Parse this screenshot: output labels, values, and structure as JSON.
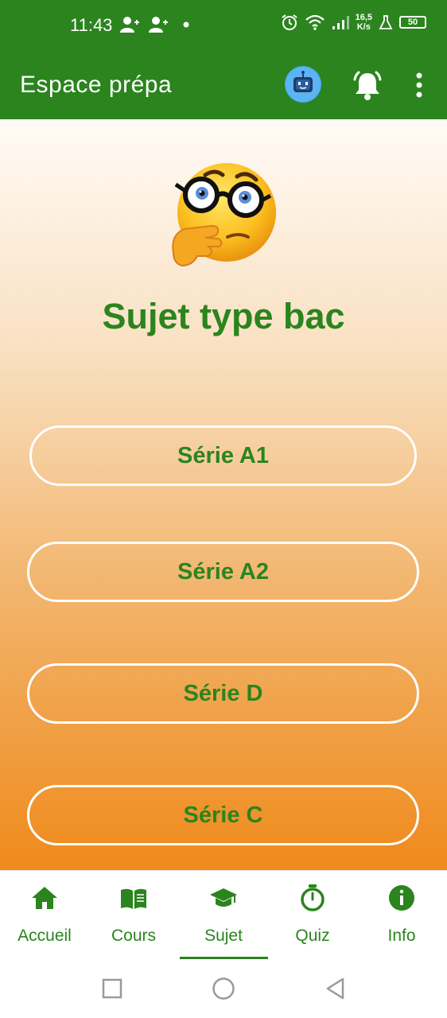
{
  "status_bar": {
    "time": "11:43",
    "speed_value": "16,5",
    "speed_unit": "K/s",
    "battery": "50",
    "icons": [
      "person-add-icon",
      "person-add-icon",
      "dot-icon",
      "alarm-icon",
      "wifi-icon",
      "signal-icon",
      "flask-icon",
      "battery-icon"
    ]
  },
  "app_bar": {
    "title": "Espace prépa",
    "icons": [
      "bot-icon",
      "bell-icon",
      "more-vert-icon"
    ]
  },
  "main": {
    "title": "Sujet type bac",
    "emoji": "thinking-nerd-emoji",
    "series": [
      {
        "label": "Série A1"
      },
      {
        "label": "Série A2"
      },
      {
        "label": "Série D"
      },
      {
        "label": "Série C"
      }
    ]
  },
  "bottom_nav": {
    "items": [
      {
        "label": "Accueil",
        "icon": "home-icon"
      },
      {
        "label": "Cours",
        "icon": "book-icon"
      },
      {
        "label": "Sujet",
        "icon": "graduation-cap-icon",
        "active": true
      },
      {
        "label": "Quiz",
        "icon": "stopwatch-icon"
      },
      {
        "label": "Info",
        "icon": "info-icon"
      }
    ]
  },
  "system_nav": {
    "icons": [
      "square-recents-icon",
      "circle-home-icon",
      "triangle-back-icon"
    ]
  },
  "colors": {
    "primary_green": "#2b841e",
    "gradient_top": "#fffbf6",
    "gradient_bottom": "#ef8a1b",
    "bot_blue": "#4aa6f0"
  }
}
